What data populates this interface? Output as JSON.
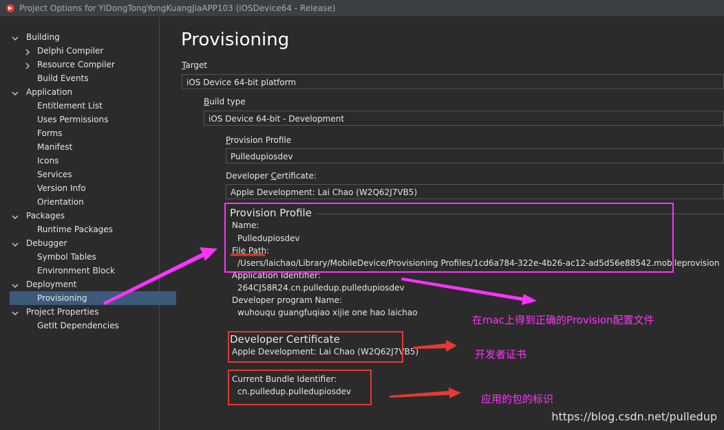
{
  "window": {
    "title": "Project Options for YiDongTongYongKuangJiaAPP103 (iOSDevice64 - Release)"
  },
  "sidebar": {
    "items": [
      {
        "label": "Building",
        "level": 0,
        "expanded": true
      },
      {
        "label": "Delphi Compiler",
        "level": 1,
        "expandable": true
      },
      {
        "label": "Resource Compiler",
        "level": 1,
        "expandable": true
      },
      {
        "label": "Build Events",
        "level": 1
      },
      {
        "label": "Application",
        "level": 0,
        "expanded": true
      },
      {
        "label": "Entitlement List",
        "level": 1
      },
      {
        "label": "Uses Permissions",
        "level": 1
      },
      {
        "label": "Forms",
        "level": 1
      },
      {
        "label": "Manifest",
        "level": 1
      },
      {
        "label": "Icons",
        "level": 1
      },
      {
        "label": "Services",
        "level": 1
      },
      {
        "label": "Version Info",
        "level": 1
      },
      {
        "label": "Orientation",
        "level": 1
      },
      {
        "label": "Packages",
        "level": 0,
        "expanded": true
      },
      {
        "label": "Runtime Packages",
        "level": 1
      },
      {
        "label": "Debugger",
        "level": 0,
        "expanded": true
      },
      {
        "label": "Symbol Tables",
        "level": 1
      },
      {
        "label": "Environment Block",
        "level": 1
      },
      {
        "label": "Deployment",
        "level": 0,
        "expanded": true
      },
      {
        "label": "Provisioning",
        "level": 1,
        "selected": true
      },
      {
        "label": "Project Properties",
        "level": 0,
        "expanded": true
      },
      {
        "label": "GetIt Dependencies",
        "level": 1
      }
    ]
  },
  "main": {
    "title": "Provisioning",
    "target": {
      "label": "Target",
      "accel": "T",
      "rest": "arget",
      "value": "iOS Device 64-bit platform"
    },
    "build_type": {
      "label": "Build type",
      "accel": "B",
      "rest": "uild type",
      "value": "iOS Device 64-bit - Development"
    },
    "provision_profile": {
      "label": "Provision Profile",
      "accel": "P",
      "rest": "rovision Profile",
      "value": "Pulledupiosdev"
    },
    "developer_certificate": {
      "pre": "Developer ",
      "accel": "C",
      "rest": "ertificate:",
      "value": "Apple Development: Lai Chao (W2Q62J7VB5)"
    },
    "profile_group": {
      "title": "Provision Profile",
      "name_label": "Name:",
      "name_value": "Pulledupiosdev",
      "path_label": "File Path:",
      "path_value": "/Users/laichao/Library/MobileDevice/Provisioning Profiles/1cd6a784-322e-4b26-ac12-ad5d56e88542.mobileprovision",
      "app_id_label": "Application Identifier:",
      "app_id_value": "264CJ58R24.cn.pulledup.pulledupiosdev",
      "dev_program_label": "Developer program Name:",
      "dev_program_value": "wuhouqu guangfuqiao xijie one hao laichao"
    },
    "cert_group": {
      "title": "Developer Certificate",
      "value": "Apple Development: Lai Chao (W2Q62J7VB5)"
    },
    "bundle": {
      "label": "Current Bundle Identifier:",
      "value": "cn.pulledup.pulledupiosdev"
    }
  },
  "annotations": {
    "provision_note": "在mac上得到正确的Provision配置文件",
    "cert_note": "开发者证书",
    "bundle_note": "应用的包的标识",
    "magenta": "#ff33ff",
    "red": "#e53935"
  },
  "watermark": "https://blog.csdn.net/pulledup"
}
